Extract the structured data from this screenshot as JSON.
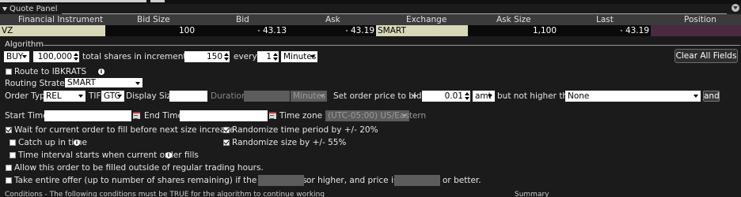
{
  "quote_panel": {
    "title": "Quote Panel",
    "columns": [
      "Financial Instrument",
      "Bid Size",
      "Bid",
      "Ask",
      "Exchange",
      "Ask Size",
      "Last",
      "Position"
    ],
    "row": {
      "instrument": "VZ",
      "bid_size": "100",
      "bid": "43.13",
      "ask": "43.19",
      "exchange": "SMART",
      "ask_size": "1,100",
      "last": "43.19",
      "position": ""
    }
  },
  "algorithm": {
    "section_label": "Algorithm",
    "side": "BUY",
    "quantity": "100,000",
    "total_shares_text": "total shares in increments of",
    "increment": "150",
    "every_text": "every",
    "interval": "1",
    "interval_unit": "Minutes",
    "clear_all_label": "Clear All Fields",
    "route_label": "Route to IBKRATS",
    "routing_strategy_label": "Routing Strategy",
    "routing_strategy": "SMART",
    "order_type_label": "Order Type",
    "order_type": "REL",
    "tif_label": "TIF",
    "tif": "GTC",
    "display_size_label": "Display Size",
    "duration_label": "Duration",
    "duration_unit": "Minutes",
    "set_price_label": "Set order price to bid",
    "plus": "+",
    "offset": "0.01",
    "offset_unit": "amt",
    "not_higher_label": "but not higher than",
    "limit": "None",
    "and_label": "and",
    "start_time_label": "Start Time",
    "end_time_label": "End Time",
    "time_zone_label": "Time zone",
    "time_zone": "(UTC-05:00) US/Eastern",
    "wait_label": "Wait for current order to fill before next size increase",
    "catch_up_label": "Catch up in time",
    "time_interval_label": "Time interval starts when current order fills",
    "randomize_time_label": "Randomize time period by +/- 20%",
    "randomize_size_label": "Randomize size by +/- 55%",
    "outside_hours_label": "Allow this order to be filled outside of regular trading hours.",
    "take_offer_label": "Take entire offer (up to number of shares remaining) if the offer size is",
    "or_higher_label": "or higher, and price is",
    "or_better_label": "or better."
  },
  "footer": {
    "conditions_label": "Conditions - The following conditions must be TRUE for the algorithm to continue working",
    "summary_label": "Summary"
  },
  "colors": {
    "instrument_bg": "#d8d8b8",
    "position_bg": "#4a2a42",
    "quote_bg": "#0a0a0a",
    "panel_bg": "#1b1b1b"
  }
}
